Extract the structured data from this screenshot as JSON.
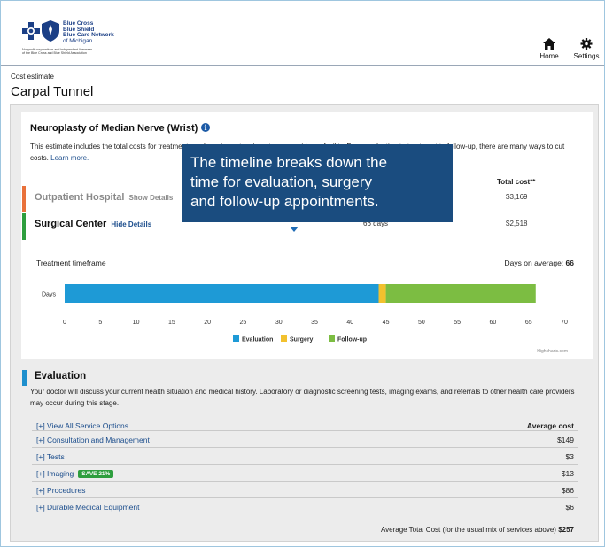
{
  "header": {
    "logo": {
      "brand_lines": [
        "Blue Cross",
        "Blue Shield",
        "Blue Care Network",
        "of Michigan"
      ],
      "fine_print": [
        "Nonprofit corporations and independent licensees",
        "of the Blue Cross and Blue Shield Association"
      ],
      "cross_color": "#1b3f86",
      "shield_color": "#1b3f86"
    },
    "nav": [
      {
        "label": "Home",
        "icon": "home-icon"
      },
      {
        "label": "Settings",
        "icon": "gear-icon"
      }
    ]
  },
  "breadcrumb": "Cost estimate",
  "page_title": "Carpal Tunnel",
  "procedure": {
    "title": "Neuroplasty of Median Nerve (Wrist)",
    "info_icon": "info-icon",
    "intro_text": "This estimate includes the total costs for treatments and services at an in-network provider or facility. From evaluation to treatment to follow-up, there are many ways to cut costs.",
    "learn_more": "Learn more."
  },
  "options": {
    "total_cost_header": "Total cost**",
    "items": [
      {
        "name": "Outpatient Hospital",
        "toggle": "Show Details",
        "days": "",
        "cost": "$3,169",
        "bar_color": "#e9713b",
        "state": "collapsed"
      },
      {
        "name": "Surgical Center",
        "toggle": "Hide Details",
        "days": "66 days",
        "cost": "$2,518",
        "bar_color": "#2e9e3e",
        "state": "expanded"
      }
    ]
  },
  "callout": {
    "lines": [
      "The timeline breaks down the",
      "time for evaluation, surgery",
      "and follow-up appointments."
    ],
    "color": "#1a4c7f"
  },
  "chart_data": {
    "type": "bar",
    "orientation": "horizontal-stacked",
    "title": "Treatment timeframe",
    "summary_label": "Days on average:",
    "summary_value": "66",
    "categories": [
      "Days"
    ],
    "series": [
      {
        "name": "Evaluation",
        "values": [
          44
        ],
        "color": "#1e9ad6"
      },
      {
        "name": "Surgery",
        "values": [
          1
        ],
        "color": "#f2c12e"
      },
      {
        "name": "Follow-up",
        "values": [
          21
        ],
        "color": "#7cbd42"
      }
    ],
    "xlim": [
      0,
      70
    ],
    "xticks": [
      0,
      5,
      10,
      15,
      20,
      25,
      30,
      35,
      40,
      45,
      50,
      55,
      60,
      65,
      70
    ],
    "grid": false,
    "legend_position": "bottom-center",
    "credit": "Highcharts.com"
  },
  "evaluation": {
    "title": "Evaluation",
    "accent": "#1e8fcd",
    "description": "Your doctor will discuss your current health situation and medical history. Laboratory or diagnostic screening tests, imaging exams, and referrals to other health care providers may occur during this stage.",
    "view_all": "[+] View All Service Options",
    "avg_cost_header": "Average cost",
    "services": [
      {
        "name": "[+] Consultation and Management",
        "cost": "$149",
        "badge": ""
      },
      {
        "name": "[+] Tests",
        "cost": "$3",
        "badge": ""
      },
      {
        "name": "[+] Imaging",
        "cost": "$13",
        "badge": "SAVE 21%"
      },
      {
        "name": "[+] Procedures",
        "cost": "$86",
        "badge": ""
      },
      {
        "name": "[+] Durable Medical Equipment",
        "cost": "$6",
        "badge": ""
      }
    ],
    "total_label": "Average Total Cost (for the usual mix of services above)",
    "total_value": "$257"
  }
}
